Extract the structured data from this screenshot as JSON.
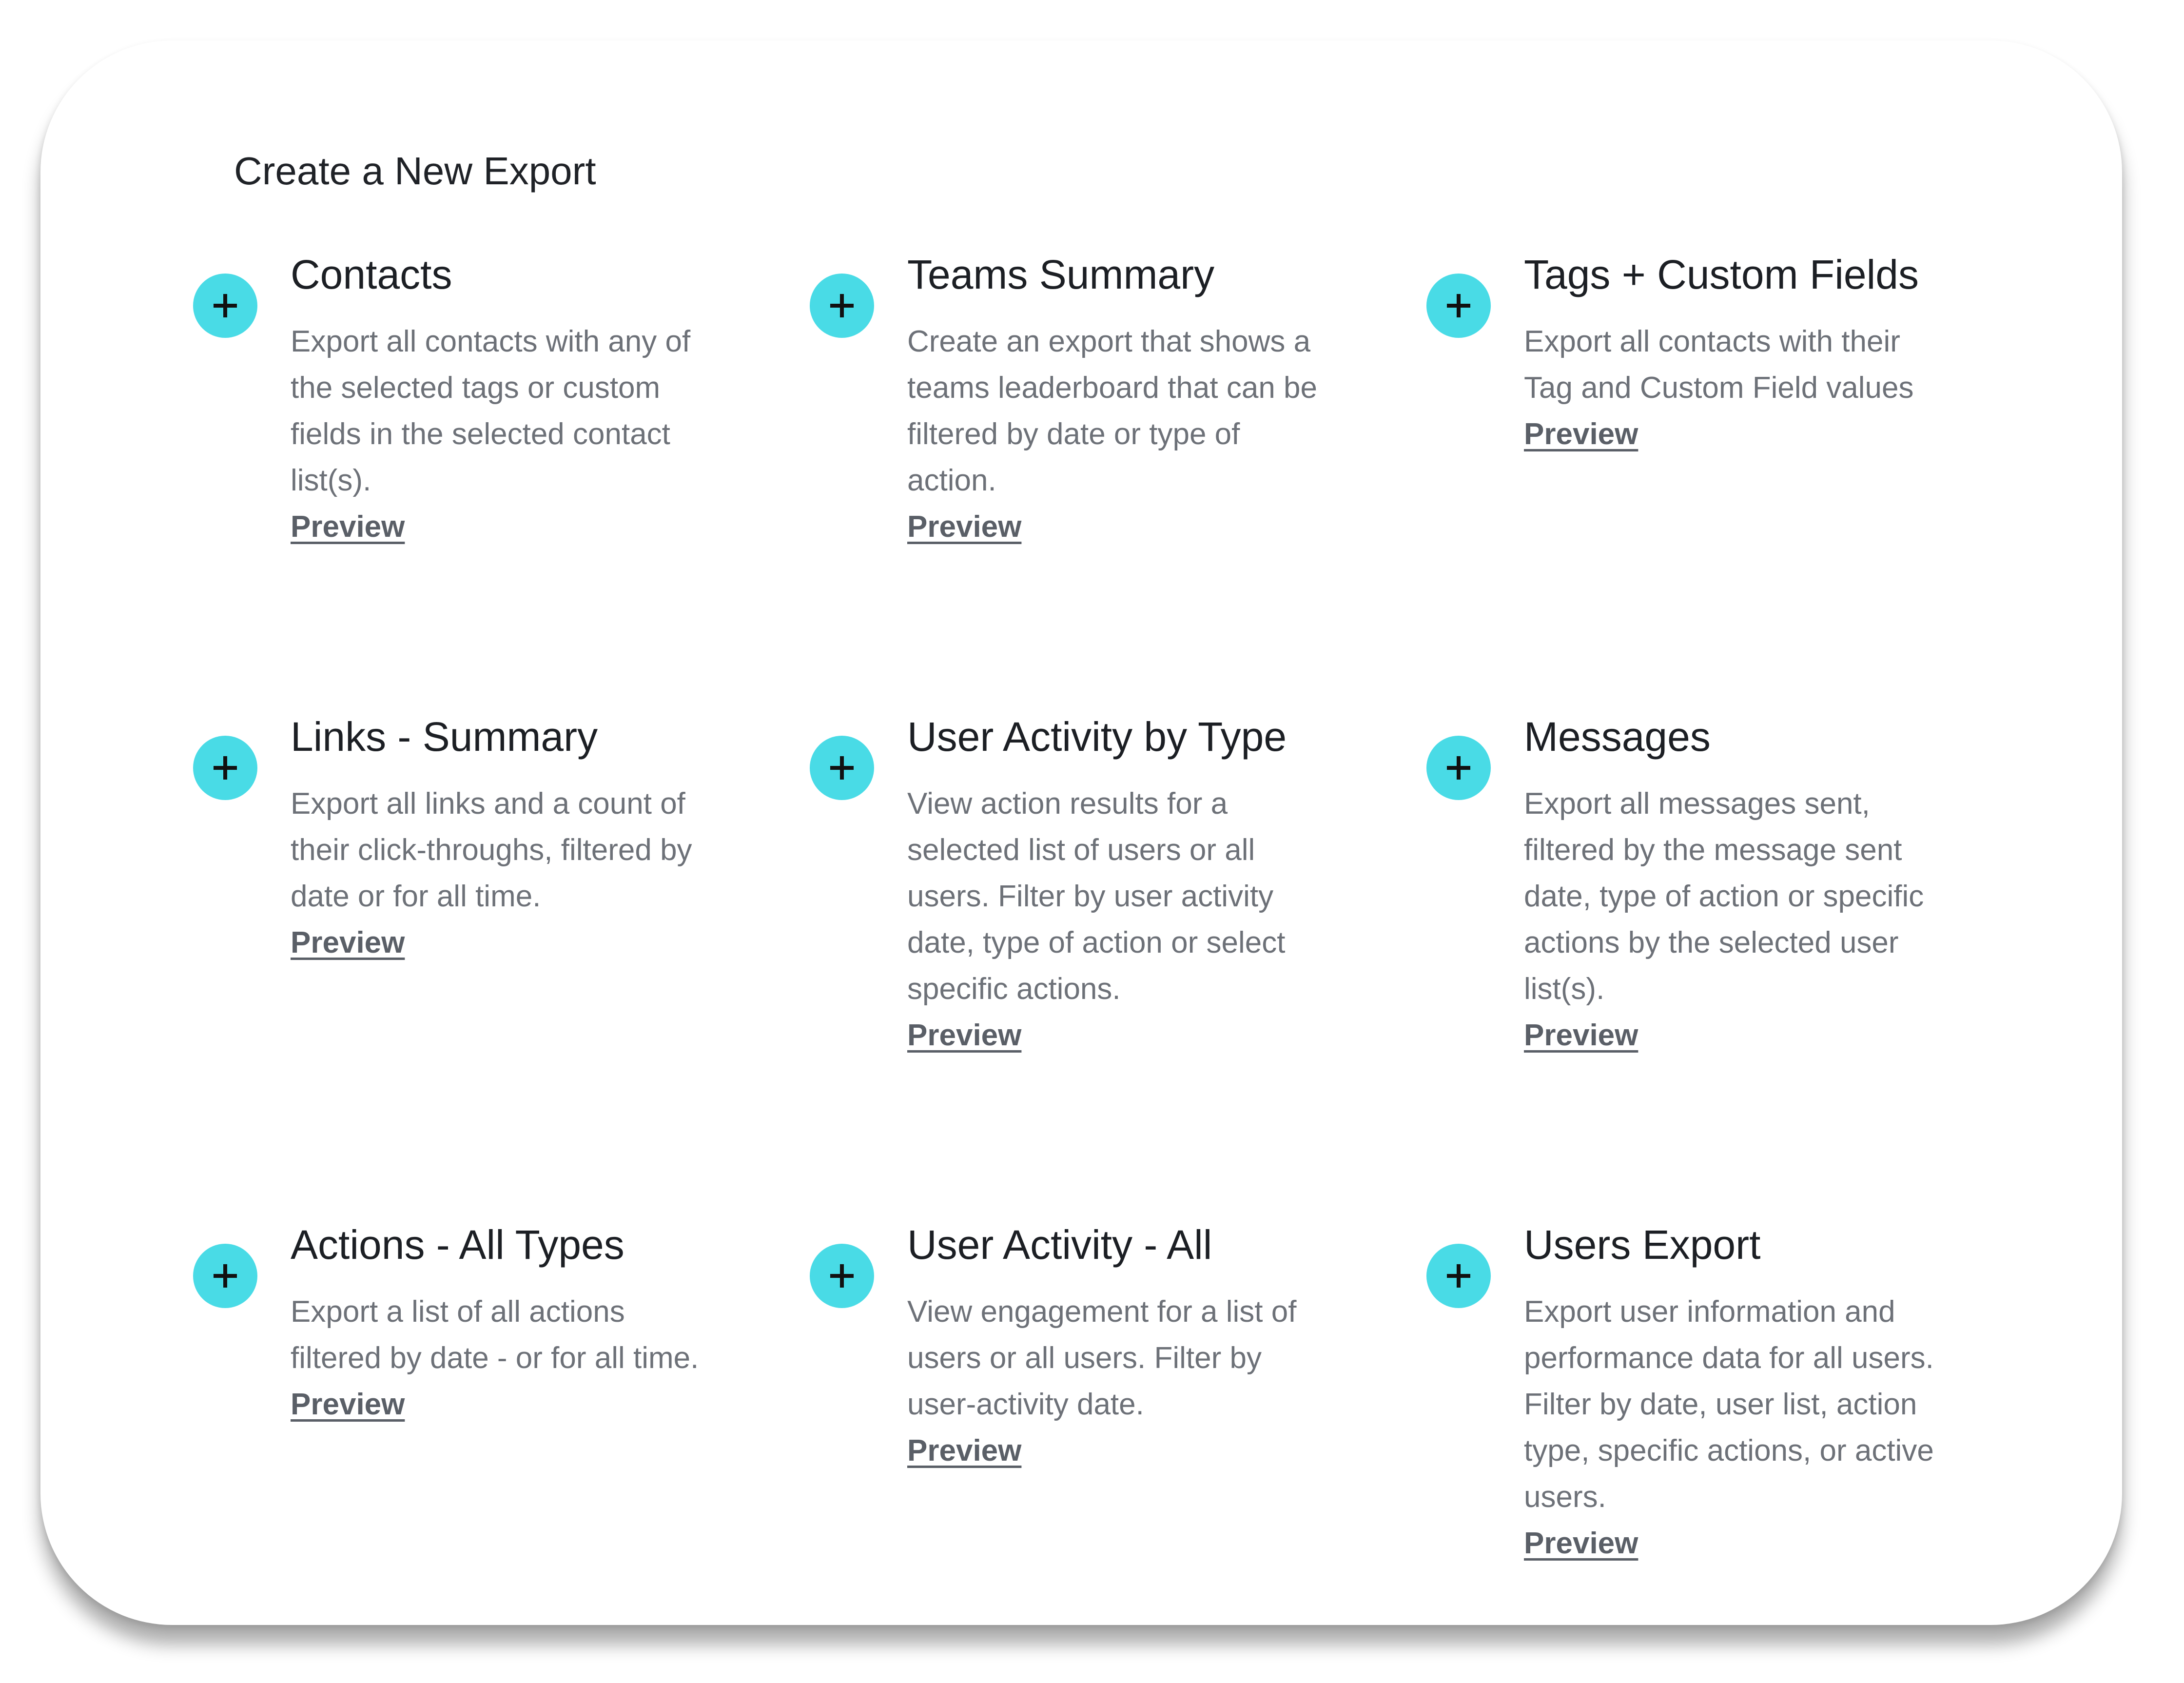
{
  "page_title": "Create a New Export",
  "accent_color": "#49dbe6",
  "add_icon": "plus-icon",
  "items": [
    {
      "title": "Contacts",
      "desc_lines": [
        "Export all contacts with any of",
        "the selected tags or custom",
        "fields in the selected contact",
        "list(s)."
      ],
      "preview": "Preview"
    },
    {
      "title": "Teams Summary",
      "desc_lines": [
        "Create an export that shows a",
        "teams leaderboard that can be",
        "filtered by date or type of",
        "action."
      ],
      "preview": "Preview"
    },
    {
      "title": "Tags + Custom Fields",
      "desc_lines": [
        "Export all contacts with their",
        "Tag and Custom Field values"
      ],
      "preview": "Preview"
    },
    {
      "title": "Links - Summary",
      "desc_lines": [
        "Export all links and a count of",
        "their click-throughs, filtered by",
        "date or for all time."
      ],
      "preview": "Preview"
    },
    {
      "title": "User Activity by Type",
      "desc_lines": [
        "View action results for a",
        "selected list of users or all",
        "users. Filter by user activity",
        "date, type of action or select",
        "specific actions."
      ],
      "preview": "Preview"
    },
    {
      "title": "Messages",
      "desc_lines": [
        "Export all messages sent,",
        "filtered by the message sent",
        "date, type of action or specific",
        "actions by the selected user",
        "list(s)."
      ],
      "preview": "Preview"
    },
    {
      "title": "Actions - All Types",
      "desc_lines": [
        "Export a list of all actions",
        "filtered by date - or for all time."
      ],
      "preview": "Preview"
    },
    {
      "title": "User Activity - All",
      "desc_lines": [
        "View engagement for a list of",
        "users or all users. Filter by",
        "user-activity date."
      ],
      "preview": "Preview"
    },
    {
      "title": "Users Export",
      "desc_lines": [
        "Export user information and",
        "performance data for all users.",
        "Filter by date, user list, action",
        "type, specific actions, or active",
        "users."
      ],
      "preview": "Preview"
    }
  ]
}
